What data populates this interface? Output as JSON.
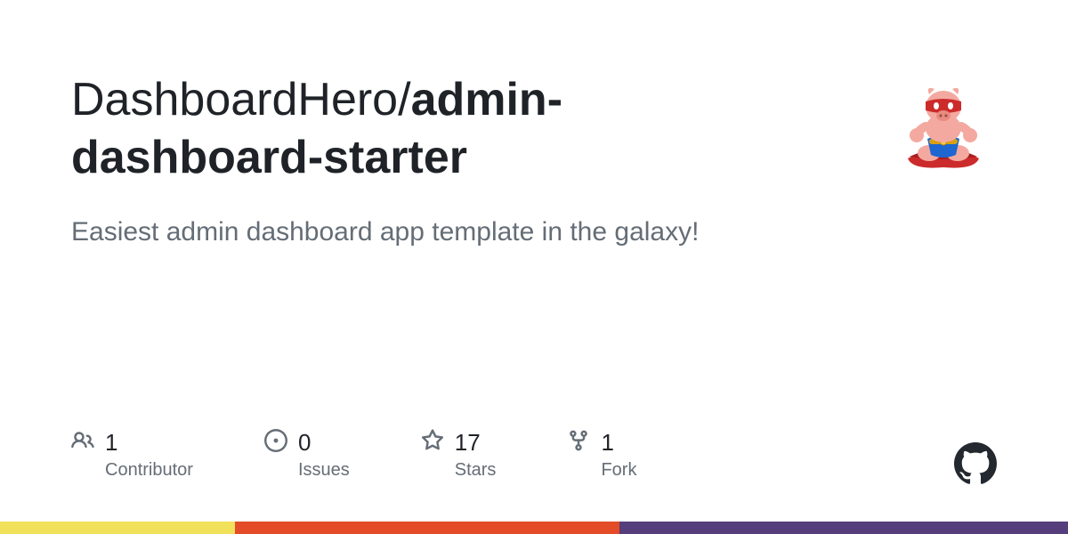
{
  "repo": {
    "owner": "DashboardHero",
    "separator": "/",
    "name": "admin-dashboard-starter"
  },
  "description": "Easiest admin dashboard app template in the galaxy!",
  "stats": [
    {
      "icon": "people-icon",
      "count": "1",
      "label": "Contributor"
    },
    {
      "icon": "issue-icon",
      "count": "0",
      "label": "Issues"
    },
    {
      "icon": "star-icon",
      "count": "17",
      "label": "Stars"
    },
    {
      "icon": "fork-icon",
      "count": "1",
      "label": "Fork"
    }
  ],
  "stripe_colors": [
    {
      "color": "#f1e05a",
      "width": "22%"
    },
    {
      "color": "#e34c26",
      "width": "36%"
    },
    {
      "color": "#563d7c",
      "width": "42%"
    }
  ]
}
